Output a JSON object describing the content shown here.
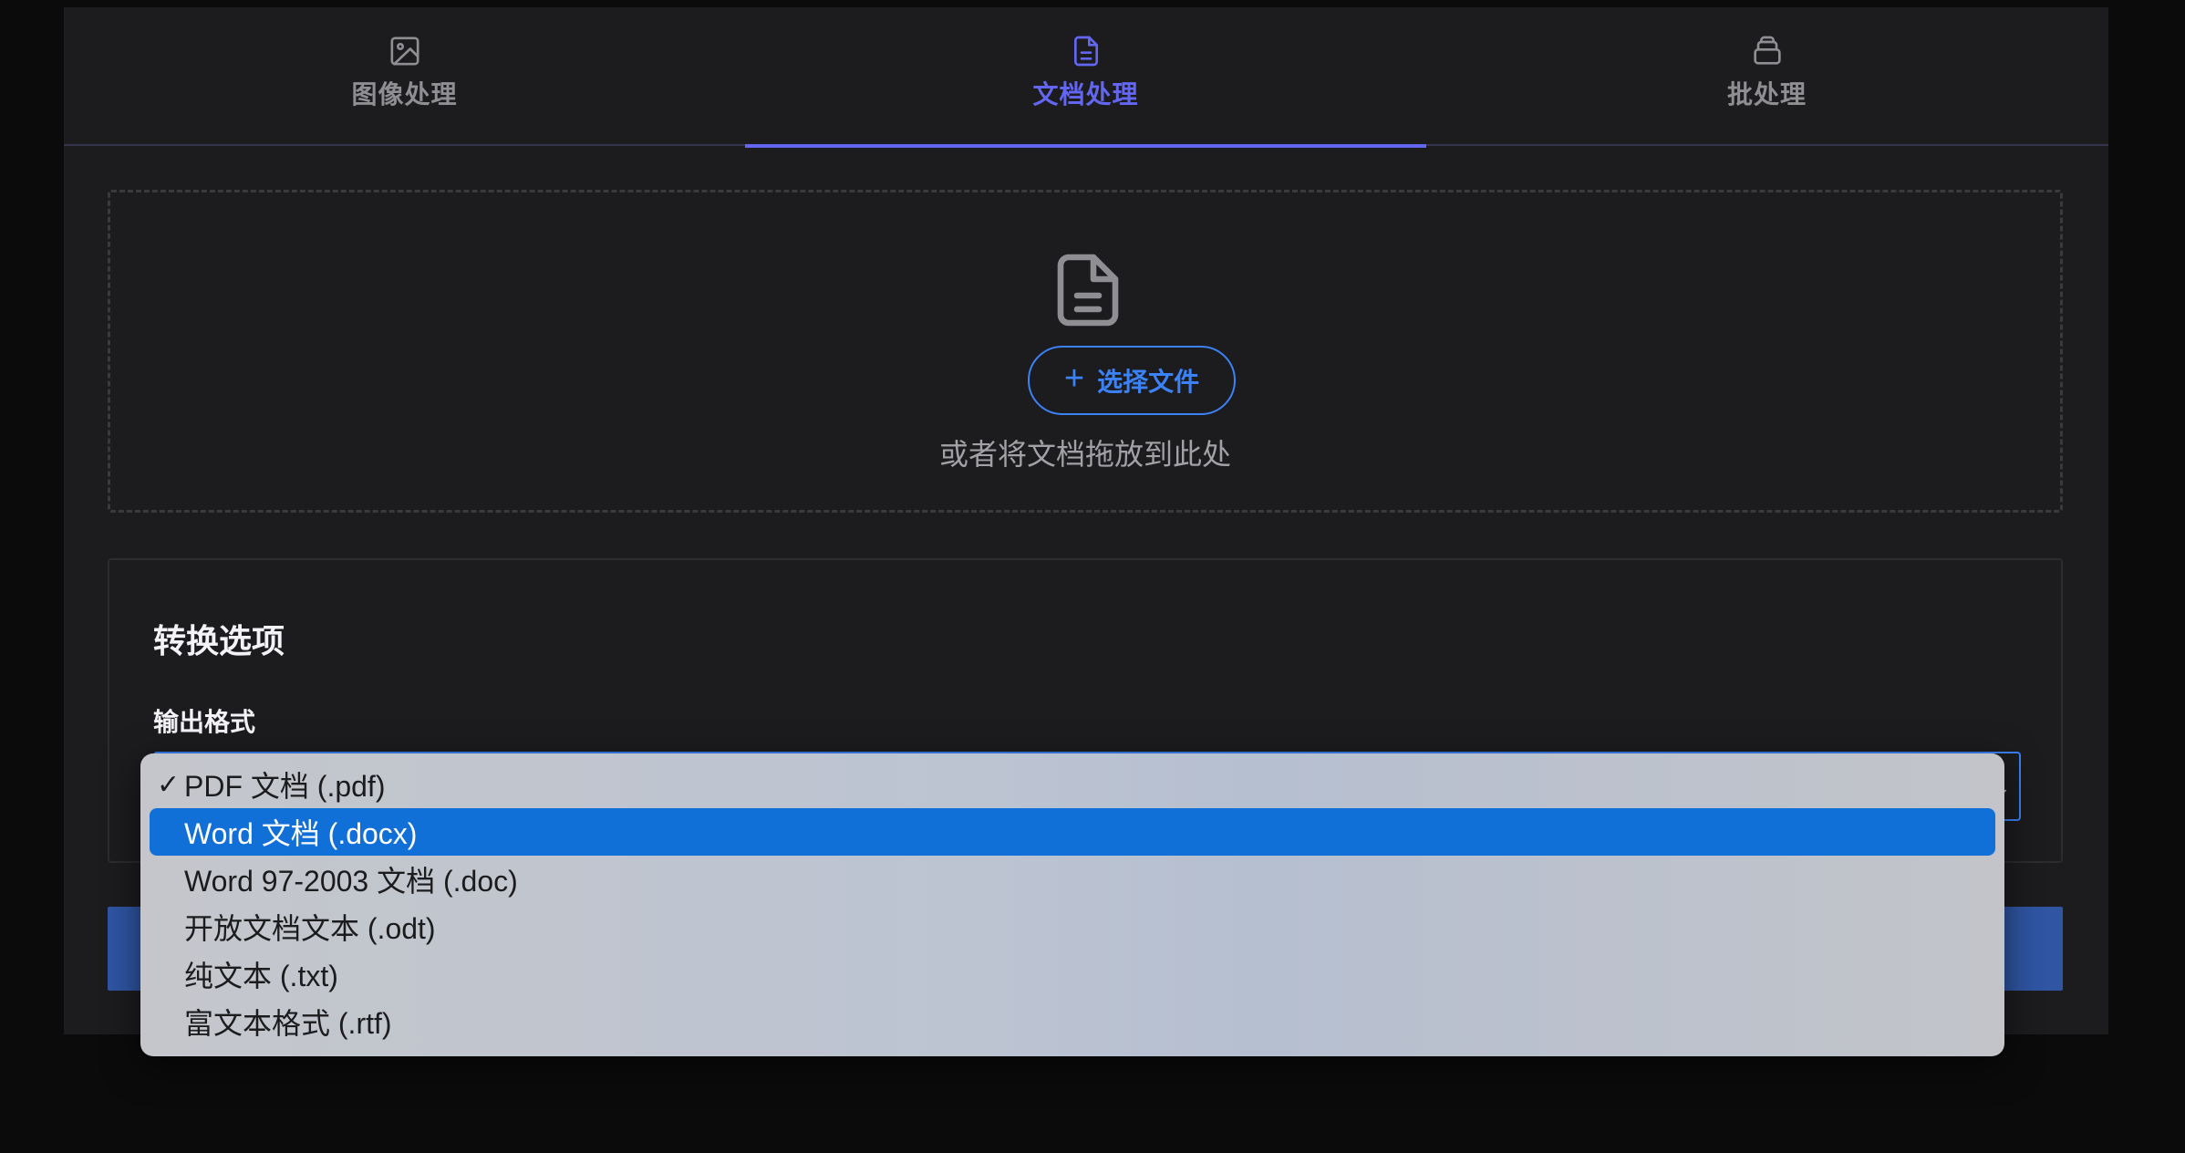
{
  "tabs": [
    {
      "label": "图像处理",
      "icon": "image-icon"
    },
    {
      "label": "文档处理",
      "icon": "document-icon"
    },
    {
      "label": "批处理",
      "icon": "batch-icon"
    }
  ],
  "active_tab": "文档处理",
  "dropzone": {
    "icon": "document-icon",
    "button_label": "选择文件",
    "hint": "或者将文档拖放到此处"
  },
  "options": {
    "title": "转换选项",
    "format_label": "输出格式",
    "selected": "PDF 文档 (.pdf)"
  },
  "dropdown": {
    "check_mark": "✓",
    "items": [
      "PDF 文档 (.pdf)",
      "Word 文档 (.docx)",
      "Word 97-2003 文档 (.doc)",
      "开放文档文本 (.odt)",
      "纯文本 (.txt)",
      "富文本格式 (.rtf)"
    ],
    "highlighted": "Word 文档 (.docx)"
  },
  "colors": {
    "accent_tab": "#6366f1",
    "accent_button": "#3b82f6",
    "highlight": "#1170d8",
    "convert_button": "#2f55a3"
  }
}
